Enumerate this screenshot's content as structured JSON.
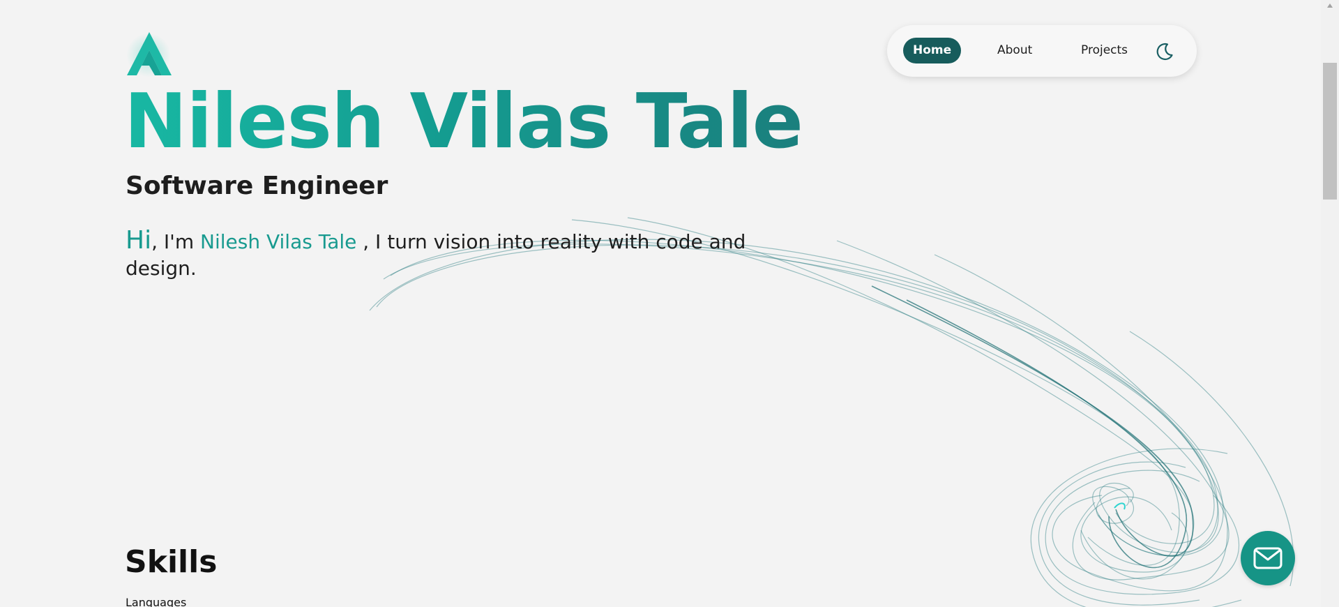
{
  "logo": {
    "icon": "a-monogram-logo-icon"
  },
  "nav": {
    "items": [
      {
        "label": "Home",
        "active": true
      },
      {
        "label": "About",
        "active": false
      },
      {
        "label": "Projects",
        "active": false
      }
    ],
    "theme_toggle_icon": "moon-icon"
  },
  "hero": {
    "name": "Nilesh Vilas Tale",
    "role": "Software Engineer",
    "intro": {
      "greeting": "Hi",
      "prefix": ", I'm ",
      "name": "Nilesh Vilas Tale",
      "suffix": " , I turn vision into reality with code and design."
    }
  },
  "skills": {
    "title": "Skills",
    "subtitle": "Languages"
  },
  "fab": {
    "icon": "mail-icon"
  },
  "colors": {
    "accent": "#189a8f",
    "nav_active_bg": "#175c5c",
    "fab_bg": "#169486",
    "background": "#f3f3f3"
  }
}
